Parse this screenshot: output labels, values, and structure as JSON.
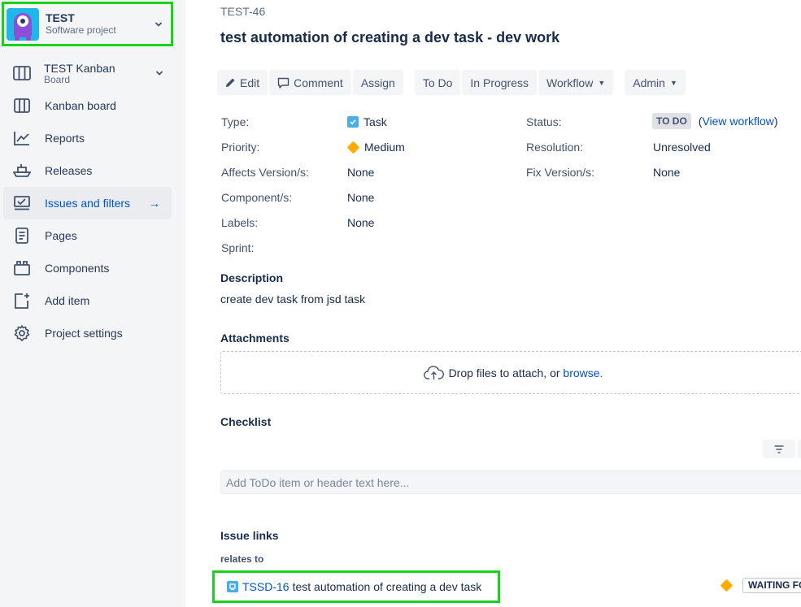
{
  "sidebar": {
    "project": {
      "name": "TEST",
      "type": "Software project"
    },
    "board": {
      "name": "TEST Kanban",
      "sub": "Board"
    },
    "items": [
      {
        "label": "Kanban board",
        "icon": "kanban-board-icon"
      },
      {
        "label": "Reports",
        "icon": "reports-icon"
      },
      {
        "label": "Releases",
        "icon": "releases-icon"
      },
      {
        "label": "Issues and filters",
        "icon": "issues-icon",
        "active": true
      },
      {
        "label": "Pages",
        "icon": "pages-icon"
      },
      {
        "label": "Components",
        "icon": "components-icon"
      },
      {
        "label": "Add item",
        "icon": "add-item-icon"
      },
      {
        "label": "Project settings",
        "icon": "gear-icon"
      }
    ]
  },
  "issue": {
    "key": "TEST-46",
    "title": "test automation of creating a dev task - dev work"
  },
  "toolbar": {
    "edit": "Edit",
    "comment": "Comment",
    "assign": "Assign",
    "todo": "To Do",
    "in_progress": "In Progress",
    "workflow": "Workflow",
    "admin": "Admin"
  },
  "fields": {
    "type_label": "Type:",
    "type_value": "Task",
    "priority_label": "Priority:",
    "priority_value": "Medium",
    "affects_label": "Affects Version/s:",
    "affects_value": "None",
    "component_label": "Component/s:",
    "component_value": "None",
    "labels_label": "Labels:",
    "labels_value": "None",
    "sprint_label": "Sprint:",
    "status_label": "Status:",
    "status_value": "TO DO",
    "view_workflow_open": "(",
    "view_workflow": "View workflow",
    "view_workflow_close": ")",
    "resolution_label": "Resolution:",
    "resolution_value": "Unresolved",
    "fix_label": "Fix Version/s:",
    "fix_value": "None"
  },
  "description": {
    "heading": "Description",
    "text": "create dev task from jsd task"
  },
  "attachments": {
    "heading": "Attachments",
    "drop_text": "Drop files to attach, or",
    "browse": "browse."
  },
  "checklist": {
    "heading": "Checklist",
    "placeholder": "Add ToDo item or header text here..."
  },
  "issue_links": {
    "heading": "Issue links",
    "relation": "relates to",
    "linked_key": "TSSD-16",
    "linked_summary": "test automation of creating a dev task",
    "linked_status": "WAITING FOR SUPPORT"
  },
  "colors": {
    "accent": "#0052cc",
    "highlight": "#19d219",
    "sidebar_bg": "#f4f5f7",
    "priority": "#ffab00"
  }
}
